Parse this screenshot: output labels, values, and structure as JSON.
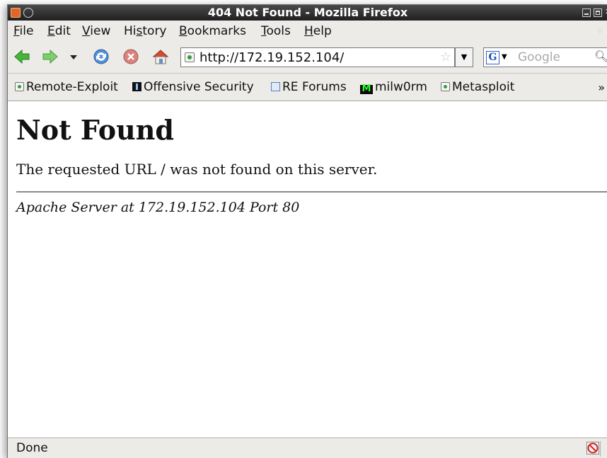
{
  "window": {
    "title": "404 Not Found - Mozilla Firefox"
  },
  "menu": {
    "items": [
      {
        "label": "File",
        "key": "F",
        "rest": "ile"
      },
      {
        "label": "Edit",
        "key": "E",
        "rest": "dit"
      },
      {
        "label": "View",
        "key": "V",
        "rest": "iew"
      },
      {
        "label": "History",
        "pre": "Hi",
        "key": "s",
        "rest": "tory"
      },
      {
        "label": "Bookmarks",
        "key": "B",
        "rest": "ookmarks"
      },
      {
        "label": "Tools",
        "key": "T",
        "rest": "ools"
      },
      {
        "label": "Help",
        "key": "H",
        "rest": "elp"
      }
    ]
  },
  "nav": {
    "url": "http://172.19.152.104/",
    "search_placeholder": "Google"
  },
  "bookmarks": [
    {
      "label": "Remote-Exploit",
      "icon": "page-icon"
    },
    {
      "label": "Offensive Security",
      "icon": "offsec-icon"
    },
    {
      "label": "RE Forums",
      "icon": "re-forums-icon"
    },
    {
      "label": "milw0rm",
      "icon": "milw0rm-icon"
    },
    {
      "label": "Metasploit",
      "icon": "page-icon"
    }
  ],
  "bookmarks_overflow": "»",
  "content": {
    "heading": "Not Found",
    "message": "The requested URL / was not found on this server.",
    "address": "Apache Server at 172.19.152.104 Port 80"
  },
  "status": {
    "text": "Done"
  },
  "colors": {
    "titlebar": "#2b2b2b",
    "chrome": "#ecebe8",
    "nav_green": "#3aa52e"
  }
}
